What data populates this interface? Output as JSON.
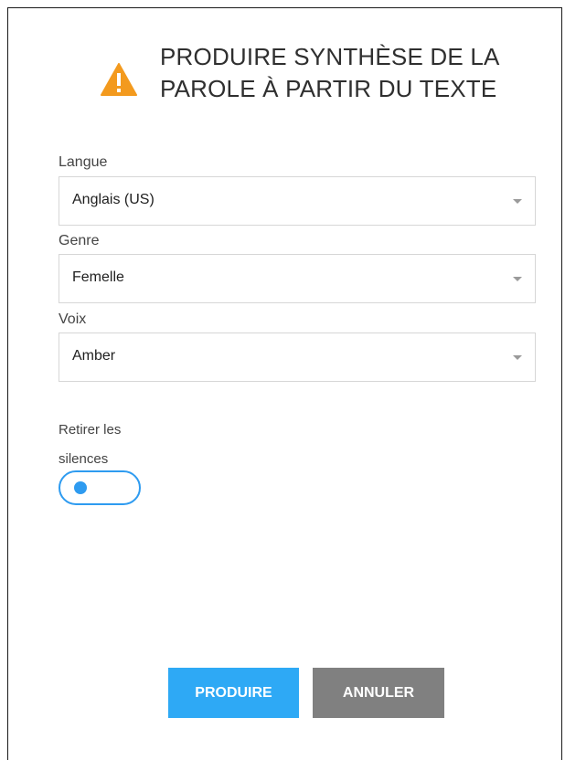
{
  "dialog": {
    "title": "PRODUIRE SYNTHÈSE DE LA PAROLE À PARTIR DU TEXTE",
    "icon": "warning-icon",
    "icon_color": "#f39a1e"
  },
  "fields": {
    "language": {
      "label": "Langue",
      "value": "Anglais (US)"
    },
    "gender": {
      "label": "Genre",
      "value": "Femelle"
    },
    "voice": {
      "label": "Voix",
      "value": "Amber"
    }
  },
  "toggle": {
    "label": "Retirer les silences",
    "state": "off",
    "accent": "#2e9bf0"
  },
  "buttons": {
    "primary": "PRODUIRE",
    "secondary": "ANNULER",
    "primary_color": "#2ea9f5",
    "secondary_color": "#808080"
  }
}
